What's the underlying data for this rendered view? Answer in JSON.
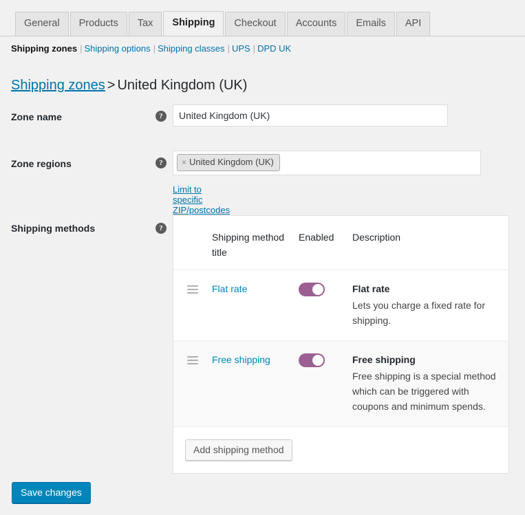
{
  "tabs": [
    {
      "label": "General",
      "active": false
    },
    {
      "label": "Products",
      "active": false
    },
    {
      "label": "Tax",
      "active": false
    },
    {
      "label": "Shipping",
      "active": true
    },
    {
      "label": "Checkout",
      "active": false
    },
    {
      "label": "Accounts",
      "active": false
    },
    {
      "label": "Emails",
      "active": false
    },
    {
      "label": "API",
      "active": false
    }
  ],
  "subnav": {
    "items": [
      {
        "label": "Shipping zones",
        "current": true
      },
      {
        "label": "Shipping options",
        "current": false
      },
      {
        "label": "Shipping classes",
        "current": false
      },
      {
        "label": "UPS",
        "current": false
      },
      {
        "label": "DPD UK",
        "current": false
      }
    ],
    "separator": "|"
  },
  "heading": {
    "link_label": "Shipping zones",
    "separator": ">",
    "title": "United Kingdom (UK)"
  },
  "help_glyph": "?",
  "zone_name": {
    "label": "Zone name",
    "value": "United Kingdom (UK)",
    "placeholder": "Zone name"
  },
  "zone_regions": {
    "label": "Zone regions",
    "chips": [
      {
        "remove_glyph": "×",
        "label": "United Kingdom (UK)"
      }
    ],
    "zip_link_label": "Limit to specific ZIP/postcodes"
  },
  "shipping_methods": {
    "label": "Shipping methods",
    "columns": {
      "handle": "",
      "title": "Shipping method title",
      "enabled": "Enabled",
      "description": "Description"
    },
    "rows": [
      {
        "title": "Flat rate",
        "enabled": true,
        "desc_title": "Flat rate",
        "desc_text": "Lets you charge a fixed rate for shipping."
      },
      {
        "title": "Free shipping",
        "enabled": true,
        "desc_title": "Free shipping",
        "desc_text": "Free shipping is a special method which can be triggered with coupons and minimum spends."
      }
    ],
    "add_button_label": "Add shipping method"
  },
  "save_button_label": "Save changes",
  "colors": {
    "page_background": "#f1f1f1",
    "link": "#0073aa",
    "method_link": "#0085ba",
    "toggle_on": "#9c5f92",
    "primary_button": "#0085ba"
  }
}
